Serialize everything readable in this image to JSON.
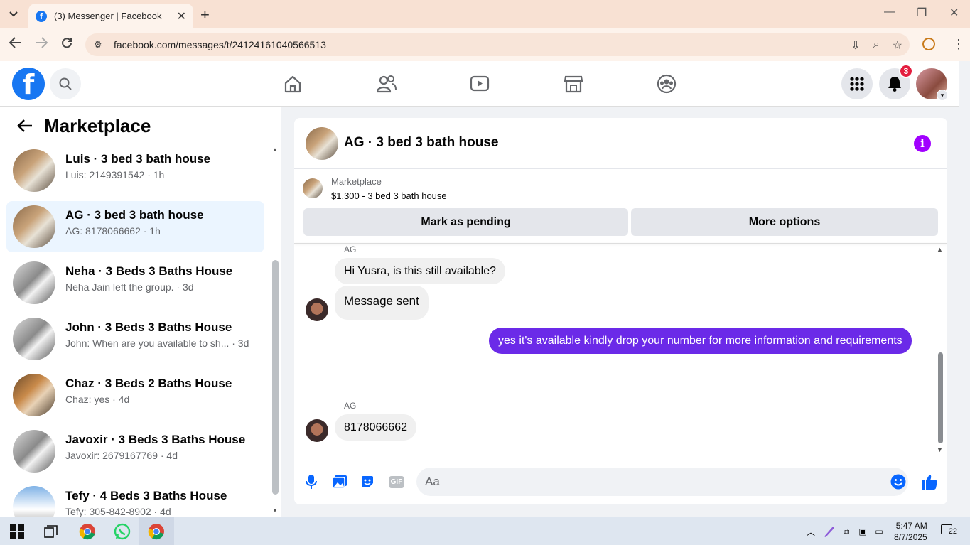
{
  "browser": {
    "tab_title": "(3) Messenger | Facebook",
    "url": "facebook.com/messages/t/24124161040566513"
  },
  "fb": {
    "notification_count": "3"
  },
  "sidebar": {
    "title": "Marketplace",
    "conversations": [
      {
        "name": "Luis · 3 bed 3 bath house",
        "preview": "Luis: 2149391542 · 1h"
      },
      {
        "name": "AG · 3 bed 3 bath house",
        "preview": "AG: 8178066662 · 1h"
      },
      {
        "name": "Neha · 3 Beds 3 Baths House",
        "preview": "Neha Jain left the group. · 3d"
      },
      {
        "name": "John · 3 Beds 3 Baths House",
        "preview": "John: When are you available to sh...  · 3d"
      },
      {
        "name": "Chaz · 3 Beds 2 Baths House",
        "preview": "Chaz: yes · 4d"
      },
      {
        "name": "Javoxir · 3 Beds 3 Baths House",
        "preview": "Javoxir: 2679167769 · 4d"
      },
      {
        "name": "Tefy · 4 Beds 3 Baths House",
        "preview": "Tefy: 305-842-8902 · 4d"
      }
    ]
  },
  "chat": {
    "title": "AG · 3 bed 3 bath house",
    "listing_label": "Marketplace",
    "listing_price": "$1,300 - 3 bed 3 bath house",
    "mark_pending_label": "Mark as pending",
    "more_options_label": "More options",
    "messages": [
      {
        "sender": "AG",
        "text": "Hi Yusra, is this still available?"
      },
      {
        "text": "Message sent"
      },
      {
        "text": "yes it's available kindly drop your number for more information and requirements"
      },
      {
        "sender": "AG",
        "text": "8178066662"
      }
    ],
    "composer_placeholder": "Aa",
    "gif_label": "GIF"
  },
  "taskbar": {
    "time": "5:47 AM",
    "date": "8/7/2025",
    "notifications": "22"
  }
}
